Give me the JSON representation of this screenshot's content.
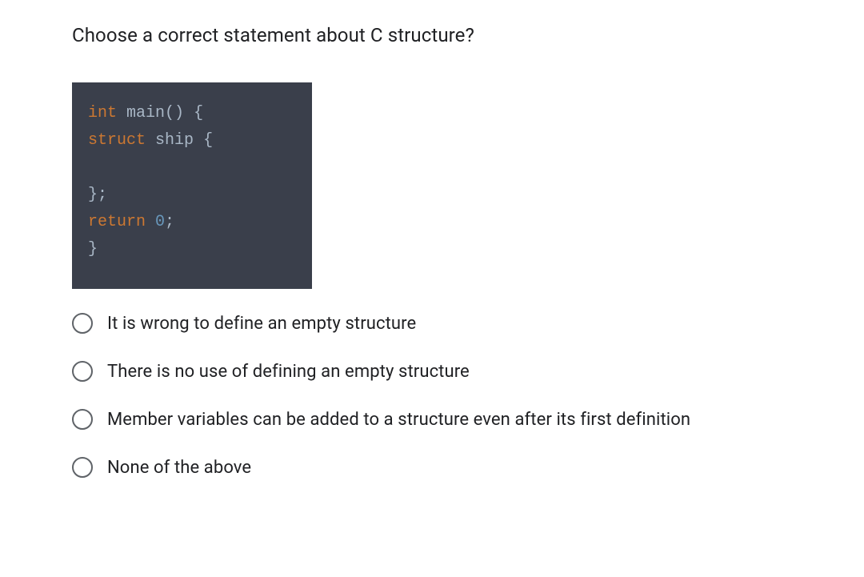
{
  "question": "Choose a correct statement about C structure?",
  "code": {
    "lines": [
      {
        "tokens": [
          {
            "t": "int",
            "c": "kw-type"
          },
          {
            "t": " ",
            "c": ""
          },
          {
            "t": "main",
            "c": "fn-name"
          },
          {
            "t": "()",
            "c": "punct"
          },
          {
            "t": " ",
            "c": ""
          },
          {
            "t": "{",
            "c": "punct"
          }
        ]
      },
      {
        "tokens": [
          {
            "t": "struct",
            "c": "kw-struct"
          },
          {
            "t": " ",
            "c": ""
          },
          {
            "t": "ship",
            "c": "ident"
          },
          {
            "t": " ",
            "c": ""
          },
          {
            "t": "{",
            "c": "punct"
          }
        ]
      },
      {
        "tokens": []
      },
      {
        "tokens": [
          {
            "t": "};",
            "c": "punct"
          }
        ]
      },
      {
        "tokens": [
          {
            "t": "return",
            "c": "kw-return"
          },
          {
            "t": " ",
            "c": ""
          },
          {
            "t": "0",
            "c": "number"
          },
          {
            "t": ";",
            "c": "punct"
          }
        ]
      },
      {
        "tokens": [
          {
            "t": "}",
            "c": "punct"
          }
        ]
      }
    ]
  },
  "options": [
    {
      "label": "It is wrong to define an empty structure"
    },
    {
      "label": "There is no use of defining an empty structure"
    },
    {
      "label": "Member variables can be added to a structure even after its first definition"
    },
    {
      "label": "None of the above"
    }
  ]
}
